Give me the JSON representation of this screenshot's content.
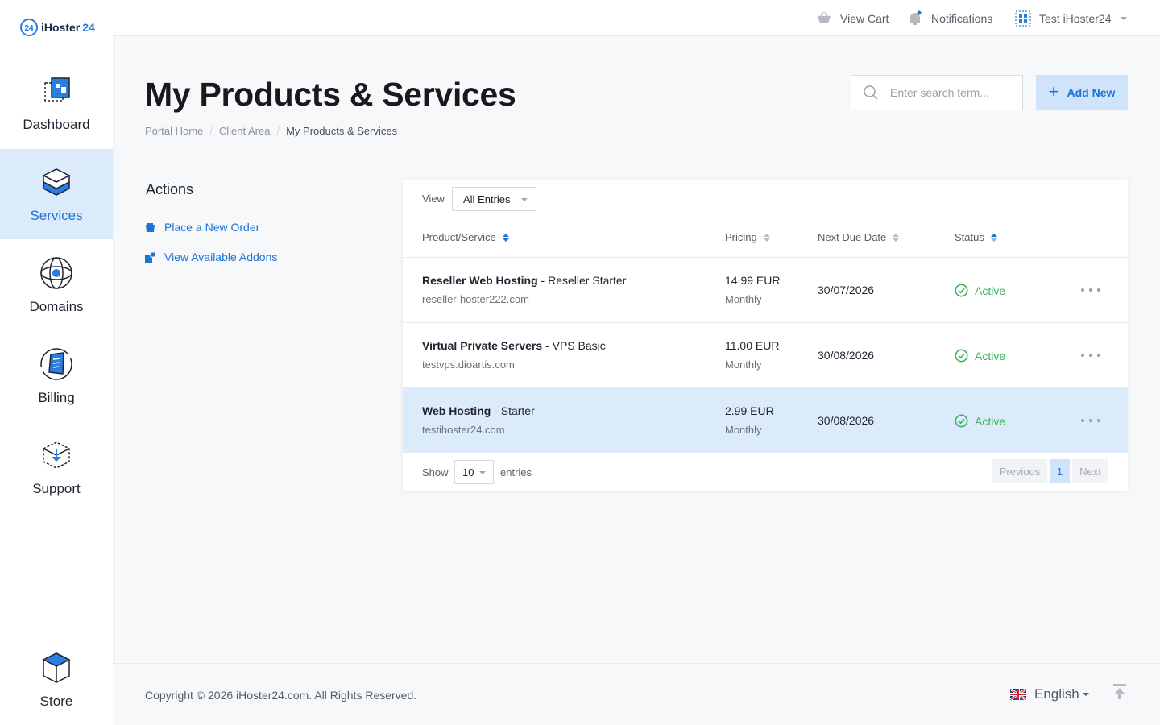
{
  "brand": {
    "logo_mark": "24",
    "name": "iHoster",
    "name_accent": "24"
  },
  "sidebar": {
    "items": [
      {
        "label": "Dashboard",
        "icon": "dashboard-icon",
        "active": false
      },
      {
        "label": "Services",
        "icon": "services-icon",
        "active": true
      },
      {
        "label": "Domains",
        "icon": "domains-icon",
        "active": false
      },
      {
        "label": "Billing",
        "icon": "billing-icon",
        "active": false
      },
      {
        "label": "Support",
        "icon": "support-icon",
        "active": false
      }
    ],
    "store": {
      "label": "Store",
      "icon": "store-icon"
    }
  },
  "topbar": {
    "cart_label": "View Cart",
    "notifications_label": "Notifications",
    "account_label": "Test iHoster24"
  },
  "page": {
    "title": "My Products & Services",
    "breadcrumb": [
      "Portal Home",
      "Client Area",
      "My Products & Services"
    ],
    "search_placeholder": "Enter search term...",
    "add_new_label": "Add New"
  },
  "actions": {
    "title": "Actions",
    "items": [
      {
        "label": "Place a New Order",
        "icon": "cart-icon"
      },
      {
        "label": "View Available Addons",
        "icon": "addons-icon"
      }
    ]
  },
  "table": {
    "view_label": "View",
    "view_value": "All Entries",
    "columns": [
      "Product/Service",
      "Pricing",
      "Next Due Date",
      "Status"
    ],
    "rows": [
      {
        "group": "Reseller Web Hosting",
        "product": " - Reseller Starter",
        "domain": "reseller-hoster222.com",
        "price": "14.99 EUR",
        "cycle": "Monthly",
        "due": "30/07/2026",
        "status": "Active"
      },
      {
        "group": "Virtual Private Servers",
        "product": " - VPS Basic",
        "domain": "testvps.dioartis.com",
        "price": "11.00 EUR",
        "cycle": "Monthly",
        "due": "30/08/2026",
        "status": "Active"
      },
      {
        "group": "Web Hosting",
        "product": " - Starter",
        "domain": "testihoster24.com",
        "price": "2.99 EUR",
        "cycle": "Monthly",
        "due": "30/08/2026",
        "status": "Active"
      }
    ],
    "show_label": "Show",
    "show_value": "10",
    "entries_label": "entries",
    "pager": {
      "previous": "Previous",
      "current": "1",
      "next": "Next"
    }
  },
  "footer": {
    "copyright": "Copyright © 2026 iHoster24.com. All Rights Reserved.",
    "language": "English"
  },
  "colors": {
    "accent": "#1a73d9",
    "active_bg": "#dcebfb",
    "status_active": "#3cb35a"
  }
}
